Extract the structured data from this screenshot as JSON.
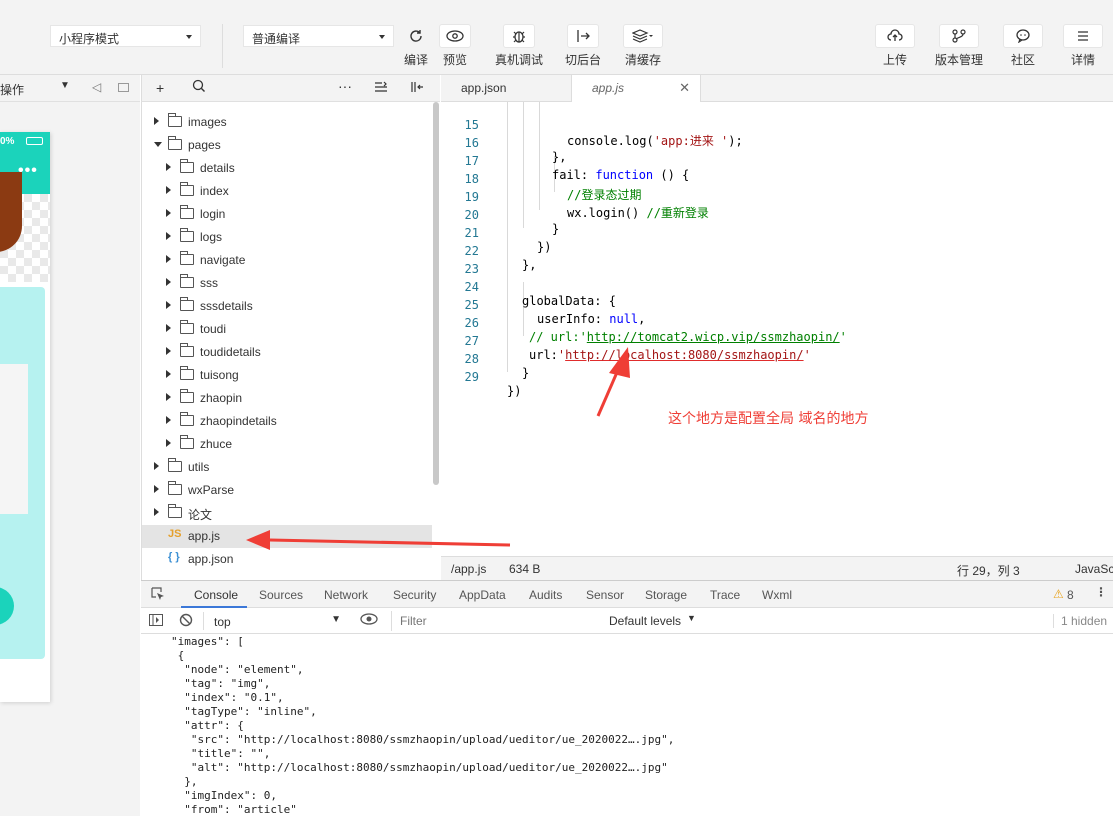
{
  "toolbar": {
    "mode_select": "小程序模式",
    "compile_select": "普通编译",
    "buttons": {
      "compile": "编译",
      "preview": "预览",
      "remote_debug": "真机调试",
      "background": "切后台",
      "clear_cache": "清缓存",
      "upload": "上传",
      "version": "版本管理",
      "community": "社区",
      "details": "详情"
    }
  },
  "simulator": {
    "header_label": "操作",
    "battery_text": "0%",
    "menu_dots": "•••"
  },
  "filetree": {
    "items": [
      {
        "name": "images",
        "type": "folder",
        "level": 0,
        "open": false
      },
      {
        "name": "pages",
        "type": "folder",
        "level": 0,
        "open": true
      },
      {
        "name": "details",
        "type": "folder",
        "level": 1,
        "open": false
      },
      {
        "name": "index",
        "type": "folder",
        "level": 1,
        "open": false
      },
      {
        "name": "login",
        "type": "folder",
        "level": 1,
        "open": false
      },
      {
        "name": "logs",
        "type": "folder",
        "level": 1,
        "open": false
      },
      {
        "name": "navigate",
        "type": "folder",
        "level": 1,
        "open": false
      },
      {
        "name": "sss",
        "type": "folder",
        "level": 1,
        "open": false
      },
      {
        "name": "sssdetails",
        "type": "folder",
        "level": 1,
        "open": false
      },
      {
        "name": "toudi",
        "type": "folder",
        "level": 1,
        "open": false
      },
      {
        "name": "toudidetails",
        "type": "folder",
        "level": 1,
        "open": false
      },
      {
        "name": "tuisong",
        "type": "folder",
        "level": 1,
        "open": false
      },
      {
        "name": "zhaopin",
        "type": "folder",
        "level": 1,
        "open": false
      },
      {
        "name": "zhaopindetails",
        "type": "folder",
        "level": 1,
        "open": false
      },
      {
        "name": "zhuce",
        "type": "folder",
        "level": 1,
        "open": false
      },
      {
        "name": "utils",
        "type": "folder",
        "level": 0,
        "open": false
      },
      {
        "name": "wxParse",
        "type": "folder",
        "level": 0,
        "open": false
      },
      {
        "name": "论文",
        "type": "folder",
        "level": 0,
        "open": false
      },
      {
        "name": "app.js",
        "type": "js",
        "level": 0,
        "selected": true
      },
      {
        "name": "app.json",
        "type": "json",
        "level": 0
      }
    ]
  },
  "editor": {
    "tabs": [
      {
        "label": "app.json",
        "active": false
      },
      {
        "label": "app.js",
        "active": true
      }
    ],
    "lines": [
      {
        "n": "15"
      },
      {
        "n": "16"
      },
      {
        "n": "17"
      },
      {
        "n": "18"
      },
      {
        "n": "19"
      },
      {
        "n": "20"
      },
      {
        "n": "21"
      },
      {
        "n": "22"
      },
      {
        "n": "23"
      },
      {
        "n": "24"
      },
      {
        "n": "25"
      },
      {
        "n": "26"
      },
      {
        "n": "27"
      },
      {
        "n": "28"
      },
      {
        "n": "29"
      }
    ],
    "code": {
      "l15a": "console.log(",
      "l15b": "'app:进来 '",
      "l15c": ");",
      "l16": "},",
      "l17a": "fail: ",
      "l17b": "function",
      "l17c": " () {",
      "l18": "//登录态过期",
      "l19a": "wx.login() ",
      "l19b": "//重新登录",
      "l20": "}",
      "l21": "})",
      "l22": "},",
      "l24": "globalData: {",
      "l25a": "userInfo: ",
      "l25b": "null",
      "l25c": ",",
      "l26a": "// url:'",
      "l26b": "http://tomcat2.wicp.vip/ssmzhaopin/",
      "l26c": "'",
      "l27a": "url:",
      "l27b": "'",
      "l27c": "http://localhost:8080/ssmzhaopin/",
      "l27d": "'",
      "l28": "}",
      "l29": "})"
    },
    "annotation": "这个地方是配置全局 域名的地方"
  },
  "statusbar": {
    "path": "/app.js",
    "size": "634 B",
    "position": "行 29，列 3",
    "language": "JavaSc"
  },
  "devtools": {
    "tabs": [
      "Console",
      "Sources",
      "Network",
      "Security",
      "AppData",
      "Audits",
      "Sensor",
      "Storage",
      "Trace",
      "Wxml"
    ],
    "warning_count": "8",
    "context": "top",
    "filter_placeholder": "Filter",
    "levels": "Default levels",
    "hidden": "1 hidden",
    "console_lines": [
      "\"images\": [",
      " {",
      "  \"node\": \"element\",",
      "  \"tag\": \"img\",",
      "  \"index\": \"0.1\",",
      "  \"tagType\": \"inline\",",
      "  \"attr\": {",
      "   \"src\": \"http://localhost:8080/ssmzhaopin/upload/ueditor/ue_2020022….jpg\",",
      "   \"title\": \"\",",
      "   \"alt\": \"http://localhost:8080/ssmzhaopin/upload/ueditor/ue_2020022….jpg\"",
      "  },",
      "  \"imgIndex\": 0,",
      "  \"from\": \"article\""
    ]
  },
  "colors": {
    "accent": "#1bd3bb",
    "annotation_red": "#ef3e36",
    "link_blue": "#3c78d8"
  }
}
